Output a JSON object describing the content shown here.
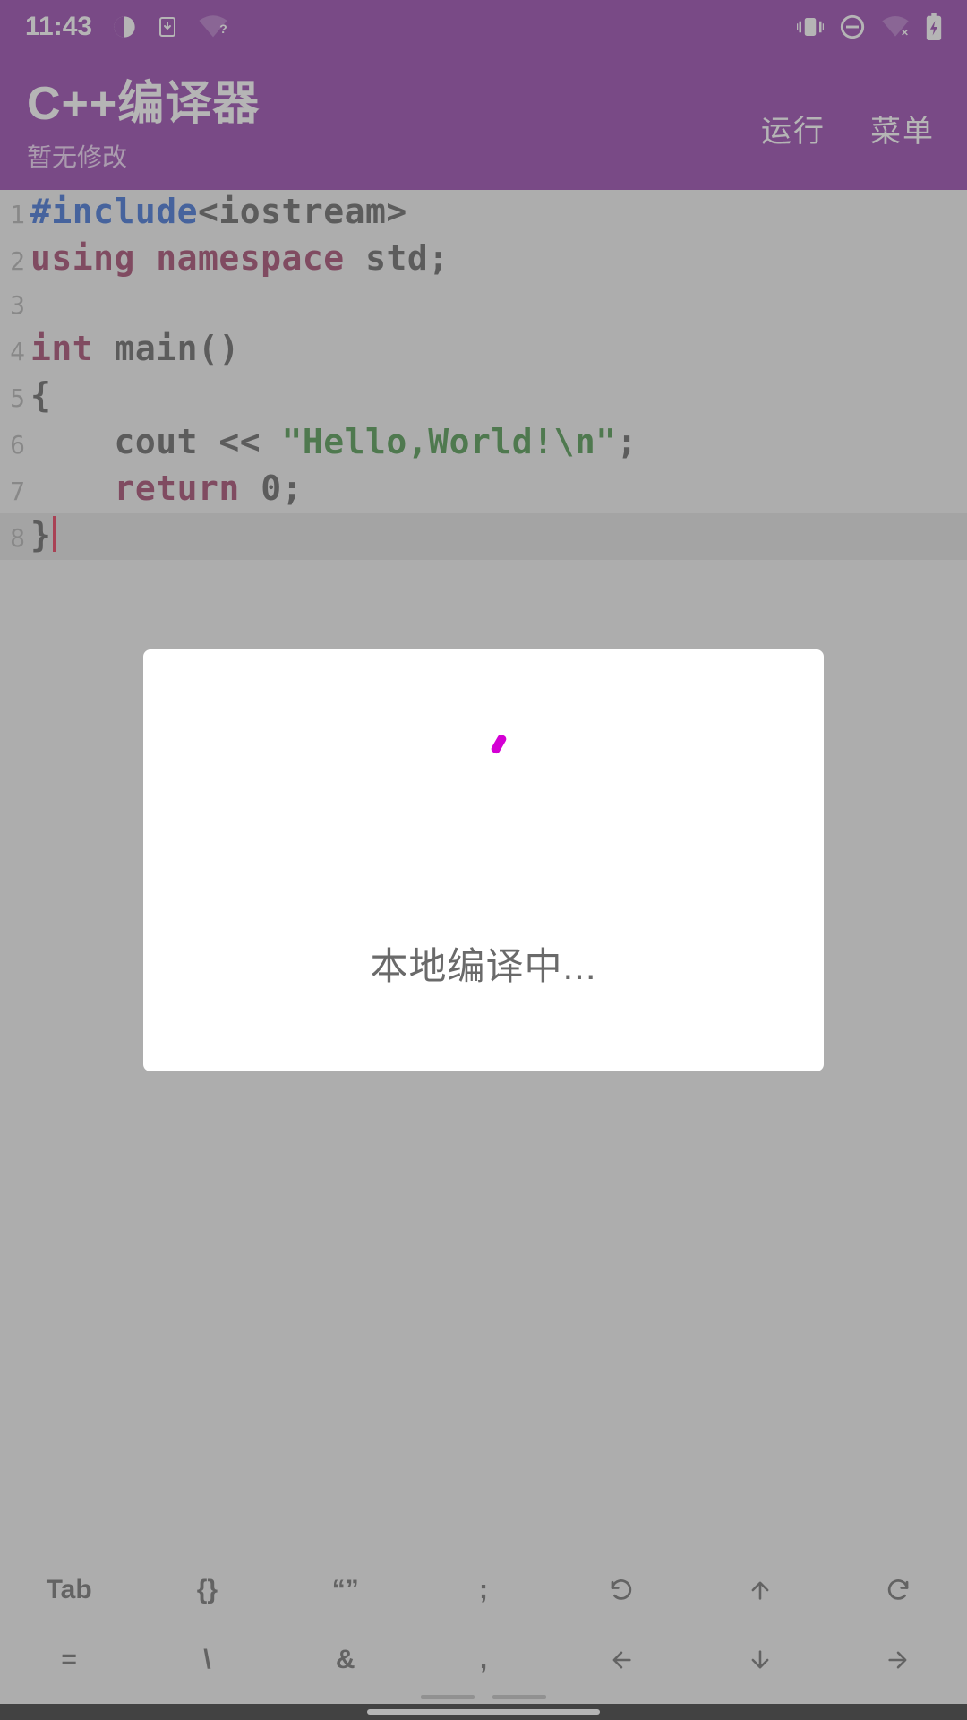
{
  "status": {
    "time": "11:43"
  },
  "header": {
    "title": "C++编译器",
    "subtitle": "暂无修改",
    "run": "运行",
    "menu": "菜单"
  },
  "code": {
    "lines": [
      {
        "n": "1",
        "tokens": [
          {
            "cls": "tok-pre",
            "t": "#include"
          },
          {
            "cls": "tok-inc",
            "t": "<iostream>"
          }
        ]
      },
      {
        "n": "2",
        "tokens": [
          {
            "cls": "tok-kw",
            "t": "using"
          },
          {
            "cls": "tok-pun",
            "t": " "
          },
          {
            "cls": "tok-kw",
            "t": "namespace"
          },
          {
            "cls": "tok-pun",
            "t": " "
          },
          {
            "cls": "tok-id",
            "t": "std"
          },
          {
            "cls": "tok-pun",
            "t": ";"
          }
        ]
      },
      {
        "n": "3",
        "tokens": []
      },
      {
        "n": "4",
        "tokens": [
          {
            "cls": "tok-kw",
            "t": "int"
          },
          {
            "cls": "tok-pun",
            "t": " "
          },
          {
            "cls": "tok-id",
            "t": "main()"
          }
        ]
      },
      {
        "n": "5",
        "tokens": [
          {
            "cls": "tok-pun",
            "t": "{"
          }
        ]
      },
      {
        "n": "6",
        "tokens": [
          {
            "cls": "tok-pun",
            "t": "    "
          },
          {
            "cls": "tok-id",
            "t": "cout"
          },
          {
            "cls": "tok-pun",
            "t": " << "
          },
          {
            "cls": "tok-str",
            "t": "\"Hello,World!\\n\""
          },
          {
            "cls": "tok-pun",
            "t": ";"
          }
        ]
      },
      {
        "n": "7",
        "tokens": [
          {
            "cls": "tok-pun",
            "t": "    "
          },
          {
            "cls": "tok-kw",
            "t": "return"
          },
          {
            "cls": "tok-pun",
            "t": " "
          },
          {
            "cls": "tok-num",
            "t": "0"
          },
          {
            "cls": "tok-pun",
            "t": ";"
          }
        ]
      },
      {
        "n": "8",
        "current": true,
        "caret": true,
        "tokens": [
          {
            "cls": "tok-pun",
            "t": "}"
          }
        ]
      }
    ]
  },
  "symbar": {
    "row1": [
      "Tab",
      "{}",
      "“”",
      ";",
      "undo-icon",
      "arrow-up-icon",
      "redo-icon"
    ],
    "row2": [
      "=",
      "\\",
      "&",
      ",",
      "arrow-left-icon",
      "arrow-down-icon",
      "arrow-right-icon"
    ]
  },
  "modal": {
    "text": "本地编译中..."
  }
}
